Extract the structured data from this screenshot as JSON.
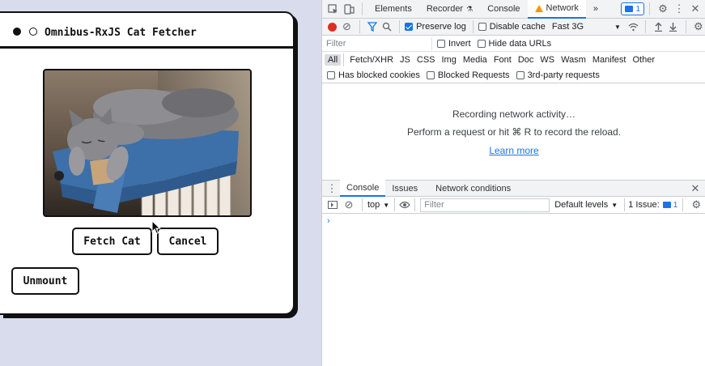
{
  "app": {
    "title": "Omnibus-RxJS Cat Fetcher",
    "fetch_label": "Fetch Cat",
    "cancel_label": "Cancel",
    "unmount_label": "Unmount"
  },
  "devtools": {
    "tabs": [
      "Elements",
      "Recorder",
      "Console",
      "Network"
    ],
    "active_tab": "Network",
    "more_tabs": "»",
    "issues_count": "1",
    "network": {
      "preserve_log": "Preserve log",
      "preserve_log_checked": true,
      "disable_cache": "Disable cache",
      "throttling": "Fast 3G",
      "filter_placeholder": "Filter",
      "invert": "Invert",
      "hide_data_urls": "Hide data URLs",
      "types": [
        "All",
        "Fetch/XHR",
        "JS",
        "CSS",
        "Img",
        "Media",
        "Font",
        "Doc",
        "WS",
        "Wasm",
        "Manifest",
        "Other"
      ],
      "blocked_cookies": "Has blocked cookies",
      "blocked_requests": "Blocked Requests",
      "third_party": "3rd-party requests",
      "empty_line1": "Recording network activity…",
      "empty_line2": "Perform a request or hit ⌘ R to record the reload.",
      "learn_more": "Learn more"
    },
    "drawer": {
      "tabs": [
        "Console",
        "Issues",
        "Network conditions"
      ],
      "context": "top",
      "filter_placeholder": "Filter",
      "levels": "Default levels",
      "issues_label": "1 Issue:",
      "issues_count": "1",
      "prompt": "›"
    }
  }
}
